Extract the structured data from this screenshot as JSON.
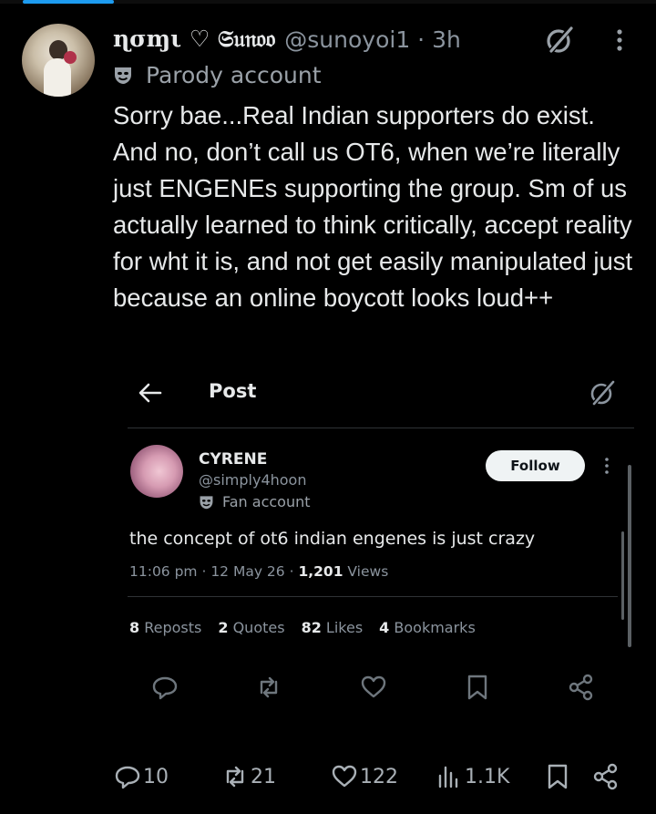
{
  "post": {
    "display_name": "ɳσɱι ♡ 𝔖𝔲𝔫𝔬𝔬",
    "handle_time": "@sunoyoi1 · 3h",
    "badge": "Parody account",
    "text": "Sorry bae...Real Indian supporters do exist. And no, don’t call us OT6, when we’re literally just ENGENEs supporting the group. Sm of us actually learned to think critically, accept reality for wht it is, and not get easily manipulated just because an online boycott looks loud++",
    "actions": {
      "replies": "10",
      "reposts": "21",
      "likes": "122",
      "views": "1.1K"
    }
  },
  "quoted_card": {
    "title": "Post",
    "name": "CYRENE",
    "handle": "@simply4hoon",
    "badge": "Fan account",
    "follow_label": "Follow",
    "text": "the concept of ot6 indian engenes is just crazy",
    "meta_time": "11:06 pm · 12 May 26 · ",
    "views_count": "1,201",
    "views_label": " Views",
    "stats": [
      {
        "count": "8",
        "label": " Reposts"
      },
      {
        "count": "2",
        "label": " Quotes"
      },
      {
        "count": "82",
        "label": " Likes"
      },
      {
        "count": "4",
        "label": " Bookmarks"
      }
    ]
  },
  "colors": {
    "background": "#000000",
    "text": "#e7e9ea",
    "muted": "#8b949e",
    "accent": "#1d9bf0"
  },
  "icons": [
    "grok-icon",
    "more-icon",
    "mask-icon",
    "back-arrow-icon",
    "reply-icon",
    "repost-icon",
    "like-icon",
    "bookmark-icon",
    "share-icon",
    "views-icon"
  ]
}
